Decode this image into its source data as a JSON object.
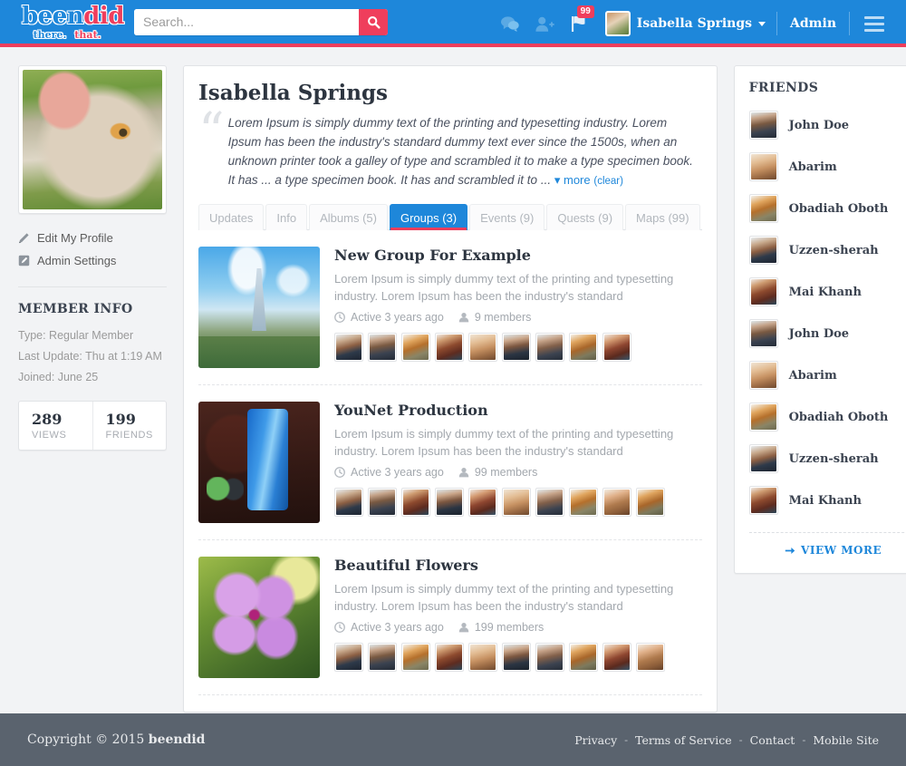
{
  "header": {
    "logo": {
      "main_a": "been",
      "main_b": "did",
      "sub_a": "there.",
      "sub_b": "that."
    },
    "search": {
      "placeholder": "Search...",
      "value": ""
    },
    "icons": {
      "chat": "chat-icon",
      "add_friend": "add-friend-icon",
      "flag": "flag-icon",
      "menu": "hamburger-icon"
    },
    "flag_badge": "99",
    "username": "Isabella Springs",
    "admin_label": "Admin",
    "colors": {
      "bar": "#1e87da",
      "accent": "#ef3e5c"
    }
  },
  "sidebar": {
    "links": [
      {
        "label": "Edit My Profile",
        "icon": "pencil-icon"
      },
      {
        "label": "Admin Settings",
        "icon": "settings-icon"
      }
    ],
    "member_info_title": "MEMBER INFO",
    "info": [
      "Type: Regular Member",
      "Last Update: Thu at 1:19 AM",
      "Joined: June 25"
    ],
    "stats": [
      {
        "number": "289",
        "label": "VIEWS"
      },
      {
        "number": "199",
        "label": "FRIENDS"
      }
    ]
  },
  "profile": {
    "name": "Isabella Springs",
    "bio": "Lorem Ipsum  is simply dummy text of the printing and typesetting industry. Lorem Ipsum has been the industry's standard dummy text ever since the 1500s, when an unknown printer took a galley of type and scrambled it to make a type specimen book. It has ... a type specimen book. It has and scrambled it to ...",
    "more_label": "more",
    "clear_label": "(clear)"
  },
  "tabs": [
    {
      "label": "Updates",
      "active": false
    },
    {
      "label": "Info",
      "active": false
    },
    {
      "label": "Albums (5)",
      "active": false
    },
    {
      "label": "Groups (3)",
      "active": true
    },
    {
      "label": "Events (9)",
      "active": false
    },
    {
      "label": "Quests (9)",
      "active": false
    },
    {
      "label": "Maps (99)",
      "active": false
    }
  ],
  "groups": [
    {
      "title": "New Group For Example",
      "description": "Lorem Ipsum  is simply dummy text of the printing and typesetting industry. Lorem Ipsum has been the industry's standard",
      "active": "Active 3 years ago",
      "members": "9 members",
      "avatar_count": 9
    },
    {
      "title": "YouNet Production",
      "description": "Lorem Ipsum  is simply dummy text of the printing and typesetting industry. Lorem Ipsum has been the industry's standard",
      "active": "Active 3 years ago",
      "members": "99 members",
      "avatar_count": 10
    },
    {
      "title": "Beautiful Flowers",
      "description": "Lorem Ipsum  is simply dummy text of the printing and typesetting industry. Lorem Ipsum has been the industry's standard",
      "active": "Active 3 years ago",
      "members": "199 members",
      "avatar_count": 10
    }
  ],
  "friends_panel": {
    "title": "FRIENDS",
    "friends": [
      {
        "name": "John Doe"
      },
      {
        "name": "Abarim"
      },
      {
        "name": "Obadiah Oboth"
      },
      {
        "name": "Uzzen-sherah"
      },
      {
        "name": "Mai Khanh"
      },
      {
        "name": "John Doe"
      },
      {
        "name": "Abarim"
      },
      {
        "name": "Obadiah Oboth"
      },
      {
        "name": "Uzzen-sherah"
      },
      {
        "name": "Mai Khanh"
      }
    ],
    "view_more": "VIEW MORE"
  },
  "footer": {
    "copyright_prefix": "Copyright © 2015",
    "brand": "beendid",
    "links": [
      "Privacy",
      "Terms of Service",
      "Contact",
      "Mobile Site"
    ],
    "separator": "-"
  }
}
